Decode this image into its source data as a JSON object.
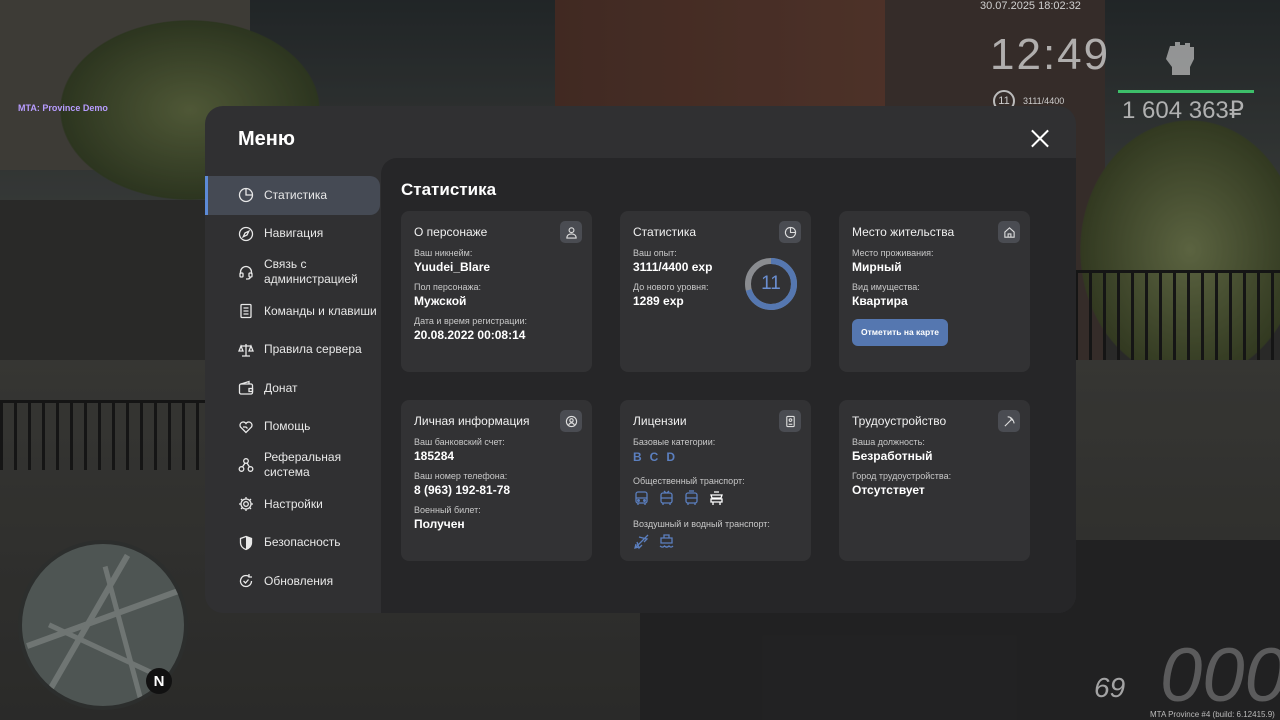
{
  "hud": {
    "watermark": "MTA: Province Demo",
    "datetime": "30.07.2025 18:02:32",
    "clock": "12:49",
    "level": "11",
    "exp": "3111/4400",
    "money": "1 604 363₽",
    "fuel": "69",
    "speed": "000",
    "build": "MTA Province #4 (build: 6.12415.9)",
    "compass": "N",
    "money_bar_color": "#3dbf6a"
  },
  "menu": {
    "title": "Меню",
    "content_title": "Статистика",
    "accent_color": "#5c8ad6"
  },
  "sidebar": {
    "items": [
      {
        "label": "Статистика",
        "icon": "pie-chart-icon",
        "active": true
      },
      {
        "label": "Навигация",
        "icon": "compass-icon"
      },
      {
        "label": "Связь с администрацией",
        "icon": "headset-icon"
      },
      {
        "label": "Команды и клавиши",
        "icon": "document-icon"
      },
      {
        "label": "Правила сервера",
        "icon": "scales-icon"
      },
      {
        "label": "Донат",
        "icon": "wallet-icon"
      },
      {
        "label": "Помощь",
        "icon": "heart-hand-icon"
      },
      {
        "label": "Реферальная система",
        "icon": "referral-icon"
      },
      {
        "label": "Настройки",
        "icon": "gear-icon"
      },
      {
        "label": "Безопасность",
        "icon": "shield-icon"
      },
      {
        "label": "Обновления",
        "icon": "refresh-icon"
      }
    ]
  },
  "cards": {
    "character": {
      "title": "О персонаже",
      "nick_label": "Ваш никнейм:",
      "nick": "Yuudei_Blare",
      "gender_label": "Пол персонажа:",
      "gender": "Мужской",
      "reg_label": "Дата и время регистрации:",
      "reg": "20.08.2022 00:08:14"
    },
    "stats": {
      "title": "Статистика",
      "exp_label": "Ваш опыт:",
      "exp": "3111/4400 exp",
      "next_label": "До нового уровня:",
      "next": "1289 exp",
      "level": "11",
      "progress": 0.707
    },
    "residence": {
      "title": "Место жительства",
      "place_label": "Место проживания:",
      "place": "Мирный",
      "type_label": "Вид имущества:",
      "type": "Квартира",
      "button": "Отметить на карте"
    },
    "personal": {
      "title": "Личная информация",
      "bank_label": "Ваш банковский счет:",
      "bank": "185284",
      "phone_label": "Ваш номер телефона:",
      "phone": "8 (963) 192-81-78",
      "military_label": "Военный билет:",
      "military": "Получен"
    },
    "licenses": {
      "title": "Лицензии",
      "basic_label": "Базовые категории:",
      "categories": [
        "B",
        "C",
        "D"
      ],
      "public_label": "Общественный транспорт:",
      "air_label": "Воздушный и водный транспорт:",
      "category_color": "#5b7fbf"
    },
    "employment": {
      "title": "Трудоустройство",
      "job_label": "Ваша должность:",
      "job": "Безработный",
      "city_label": "Город трудоустройства:",
      "city": "Отсутствует"
    }
  }
}
